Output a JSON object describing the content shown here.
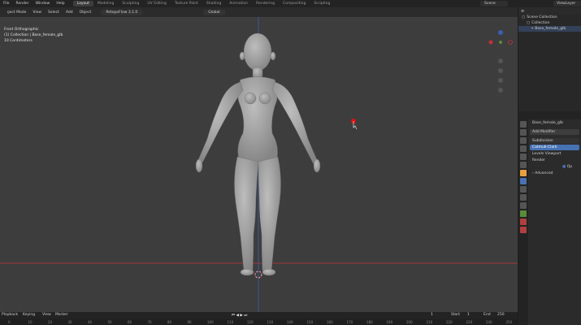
{
  "menubar": {
    "items": [
      "File",
      "Render",
      "Window",
      "Help"
    ],
    "workspaces": [
      "Layout",
      "Modeling",
      "Sculpting",
      "UV Editing",
      "Texture Paint",
      "Shading",
      "Animation",
      "Rendering",
      "Compositing",
      "Scripting"
    ],
    "active_workspace": "Layout",
    "scene": "Scene",
    "view_layer": "ViewLayer"
  },
  "viewport": {
    "mode": "Object Mode",
    "menus": [
      "View",
      "Select",
      "Add",
      "Object"
    ],
    "addon": "RetopoFlow 3.1.0",
    "transform": "Global",
    "overlay_line1": "Front Orthographic",
    "overlay_line2": "(1) Collection | Base_female_glb",
    "overlay_line3": "10 Centimeters"
  },
  "outliner": {
    "title": "Scene Collection",
    "collection": "Collection",
    "object": "Base_female_glb"
  },
  "properties": {
    "object_name": "Base_female_glb",
    "add_modifier": "Add Modifier",
    "modifier": "Subdivision",
    "mode": "Catmull-Clark",
    "levels_label": "Levels Viewport",
    "render_label": "Render",
    "optimal": "Op",
    "advanced": "Advanced"
  },
  "timeline": {
    "menus": [
      "Playback",
      "Keying",
      "View",
      "Marker"
    ],
    "start_label": "Start",
    "end_label": "End",
    "current_frame": "1",
    "start_frame": "1",
    "end_frame": "250",
    "ticks": [
      "0",
      "10",
      "20",
      "30",
      "40",
      "50",
      "60",
      "70",
      "80",
      "90",
      "100",
      "110",
      "120",
      "130",
      "140",
      "150",
      "160",
      "170",
      "180",
      "190",
      "200",
      "210",
      "220",
      "230",
      "240",
      "250"
    ]
  },
  "colors": {
    "accent": "#4772b3",
    "axis_x": "#c4303a",
    "axis_z": "#3a5fb0",
    "model": "#9b9b9b"
  }
}
